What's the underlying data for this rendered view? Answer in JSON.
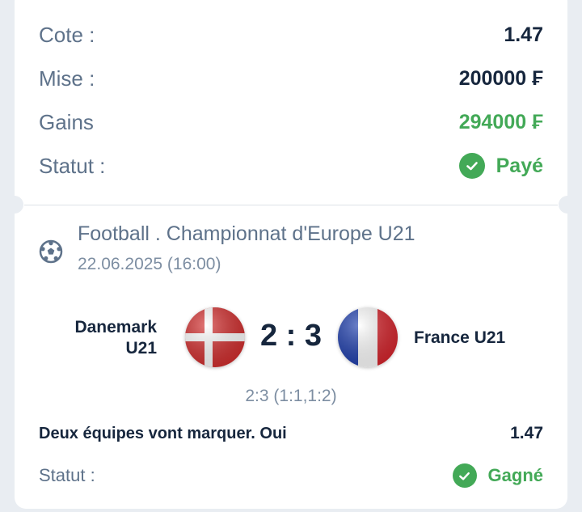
{
  "summary": {
    "odds_label": "Cote :",
    "odds_value": "1.47",
    "stake_label": "Mise :",
    "stake_value": "200000 ₣",
    "winnings_label": "Gains",
    "winnings_value": "294000 ₣",
    "status_label": "Statut :",
    "status_value": "Payé"
  },
  "event": {
    "sport_icon": "soccer-ball-icon",
    "title": "Football . Championnat d'Europe U21",
    "datetime": "22.06.2025 (16:00)",
    "home_team": "Danemark U21",
    "away_team": "France U21",
    "score": "2 : 3",
    "score_detail": "2:3 (1:1,1:2)"
  },
  "bet": {
    "market": "Deux équipes vont marquer. Oui",
    "odds": "1.47",
    "status_label": "Statut :",
    "status_value": "Gagné"
  },
  "colors": {
    "accent_green": "#43a957",
    "text_dark": "#16263d",
    "text_muted": "#5e728a"
  }
}
